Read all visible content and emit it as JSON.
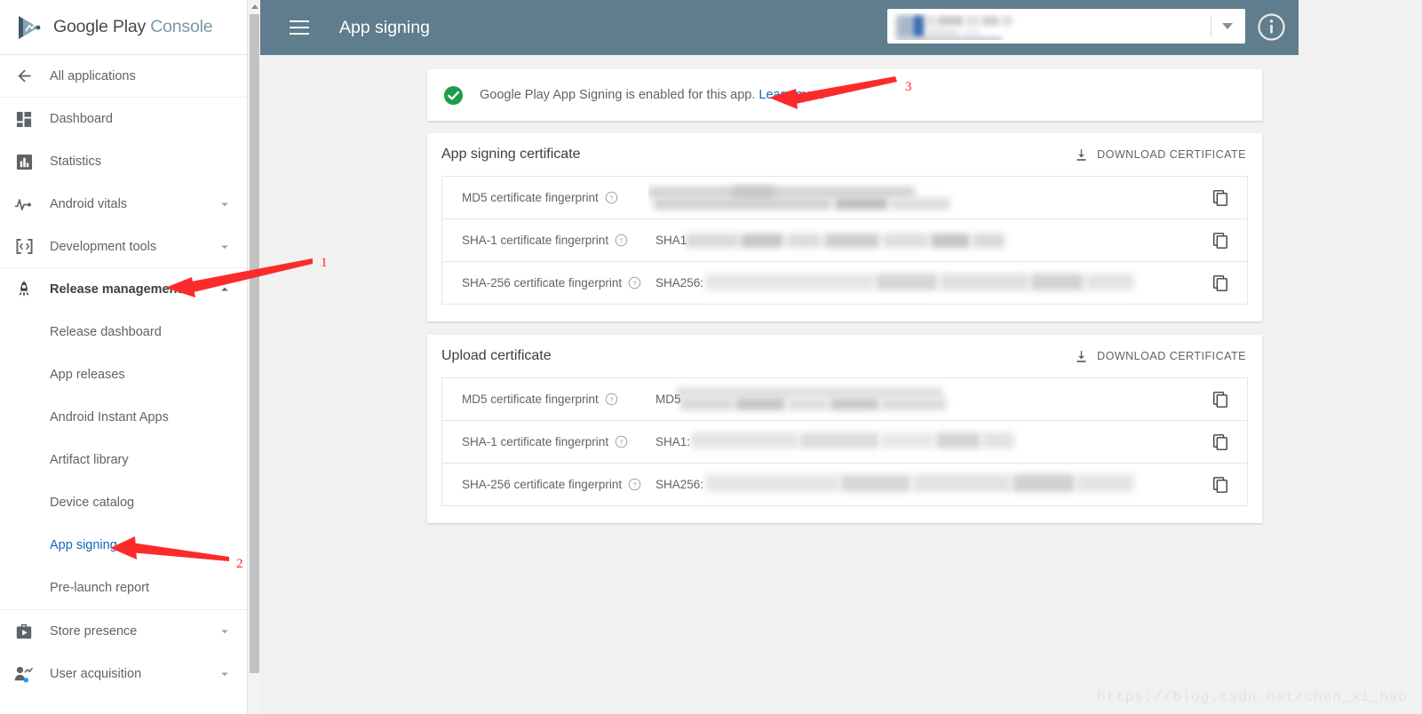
{
  "brand": {
    "word1": "Google Play",
    "word2": "Console",
    "logo_icon": "play-console-logo-icon"
  },
  "sidebar": {
    "back": {
      "label": "All applications",
      "icon": "arrow-left-icon"
    },
    "items": [
      {
        "label": "Dashboard",
        "icon": "dashboard-icon",
        "expandable": false
      },
      {
        "label": "Statistics",
        "icon": "bar-chart-icon",
        "expandable": false
      },
      {
        "label": "Android vitals",
        "icon": "pulse-icon",
        "expandable": true,
        "chevron": "chevron-down-icon"
      },
      {
        "label": "Development tools",
        "icon": "code-brackets-icon",
        "expandable": true,
        "chevron": "chevron-down-icon"
      },
      {
        "label": "Release management",
        "icon": "rocket-icon",
        "expandable": true,
        "chevron": "chevron-up-icon",
        "selected_parent": true
      },
      {
        "label": "Store presence",
        "icon": "store-icon",
        "expandable": true,
        "chevron": "chevron-down-icon"
      },
      {
        "label": "User acquisition",
        "icon": "user-acquisition-icon",
        "expandable": true,
        "chevron": "chevron-down-icon"
      }
    ],
    "release_management_children": [
      {
        "label": "Release dashboard",
        "active": false
      },
      {
        "label": "App releases",
        "active": false
      },
      {
        "label": "Android Instant Apps",
        "active": false
      },
      {
        "label": "Artifact library",
        "active": false
      },
      {
        "label": "Device catalog",
        "active": false
      },
      {
        "label": "App signing",
        "active": true
      },
      {
        "label": "Pre-launch report",
        "active": false
      }
    ],
    "scrollbar": {
      "icon": "scroll-up-arrow-icon"
    }
  },
  "header": {
    "menu_icon": "hamburger-menu-icon",
    "title": "App signing",
    "app_selector": {
      "value": "",
      "caret_icon": "dropdown-caret-icon"
    },
    "info_icon": "info-circle-icon",
    "bg_color": "#5f7d8c"
  },
  "banner": {
    "status_icon": "green-check-circle-icon",
    "text": "Google Play App Signing is enabled for this app.",
    "link_label": "Learn more",
    "link_color": "#1565c0",
    "icon_color": "#1e9e4a"
  },
  "cards": [
    {
      "title": "App signing certificate",
      "download_label": "DOWNLOAD CERTIFICATE",
      "download_icon": "download-icon",
      "rows": [
        {
          "label": "MD5 certificate fingerprint",
          "help_icon": "help-circle-icon",
          "prefix": "",
          "value": "",
          "copy_icon": "copy-icon"
        },
        {
          "label": "SHA-1 certificate fingerprint",
          "help_icon": "help-circle-icon",
          "prefix": "SHA1",
          "value": "",
          "copy_icon": "copy-icon"
        },
        {
          "label": "SHA-256 certificate fingerprint",
          "help_icon": "help-circle-icon",
          "prefix": "SHA256:",
          "value": "",
          "copy_icon": "copy-icon"
        }
      ]
    },
    {
      "title": "Upload certificate",
      "download_label": "DOWNLOAD CERTIFICATE",
      "download_icon": "download-icon",
      "rows": [
        {
          "label": "MD5 certificate fingerprint",
          "help_icon": "help-circle-icon",
          "prefix": "MD5",
          "value": "",
          "copy_icon": "copy-icon"
        },
        {
          "label": "SHA-1 certificate fingerprint",
          "help_icon": "help-circle-icon",
          "prefix": "SHA1:",
          "value": "",
          "copy_icon": "copy-icon"
        },
        {
          "label": "SHA-256 certificate fingerprint",
          "help_icon": "help-circle-icon",
          "prefix": "SHA256:",
          "value": "",
          "copy_icon": "copy-icon"
        }
      ]
    }
  ],
  "annotations": {
    "color": "#ff2222",
    "markers": [
      {
        "number": "1",
        "points_to": "Release management"
      },
      {
        "number": "2",
        "points_to": "App signing"
      },
      {
        "number": "3",
        "points_to": "Learn more"
      }
    ]
  },
  "watermark": {
    "text": "https://blog.csdn.net/chen_xi_hao"
  }
}
